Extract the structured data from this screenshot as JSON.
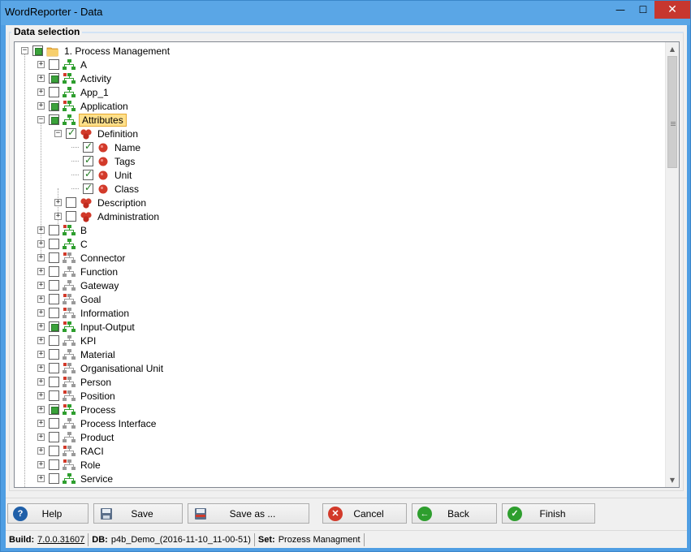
{
  "window": {
    "title": "WordReporter - Data",
    "minimize_glyph": "—",
    "maximize_glyph": "☐",
    "close_glyph": "✕"
  },
  "group": {
    "label": "Data selection"
  },
  "tree": [
    {
      "text": "1. Process Management",
      "level": 0,
      "expander": "−",
      "check": "partial",
      "icon": "folder-icon"
    },
    {
      "text": "A",
      "level": 1,
      "expander": "+",
      "check": "none",
      "icon": "hierarchy-green-icon"
    },
    {
      "text": "Activity",
      "level": 1,
      "expander": "+",
      "check": "partial",
      "icon": "hierarchy-green-red-icon"
    },
    {
      "text": "App_1",
      "level": 1,
      "expander": "+",
      "check": "none",
      "icon": "hierarchy-green-icon"
    },
    {
      "text": "Application",
      "level": 1,
      "expander": "+",
      "check": "partial",
      "icon": "hierarchy-green-red-icon"
    },
    {
      "text": "Attributes",
      "level": 1,
      "expander": "−",
      "check": "partial",
      "icon": "hierarchy-green-icon",
      "selected": true
    },
    {
      "text": "Definition",
      "level": 2,
      "expander": "−",
      "check": "checked",
      "icon": "attribute-group-icon"
    },
    {
      "text": "Name",
      "level": 3,
      "expander": "",
      "check": "checked",
      "icon": "attribute-icon"
    },
    {
      "text": "Tags",
      "level": 3,
      "expander": "",
      "check": "checked",
      "icon": "attribute-icon"
    },
    {
      "text": "Unit",
      "level": 3,
      "expander": "",
      "check": "checked",
      "icon": "attribute-icon"
    },
    {
      "text": "Class",
      "level": 3,
      "expander": "",
      "check": "checked",
      "icon": "attribute-icon"
    },
    {
      "text": "Description",
      "level": 2,
      "expander": "+",
      "check": "none",
      "icon": "attribute-group-icon"
    },
    {
      "text": "Administration",
      "level": 2,
      "expander": "+",
      "check": "none",
      "icon": "attribute-group-icon"
    },
    {
      "text": "B",
      "level": 1,
      "expander": "+",
      "check": "none",
      "icon": "hierarchy-green-red-icon"
    },
    {
      "text": "C",
      "level": 1,
      "expander": "+",
      "check": "none",
      "icon": "hierarchy-green-icon"
    },
    {
      "text": "Connector",
      "level": 1,
      "expander": "+",
      "check": "none",
      "icon": "hierarchy-gray-red-icon"
    },
    {
      "text": "Function",
      "level": 1,
      "expander": "+",
      "check": "none",
      "icon": "hierarchy-gray-icon"
    },
    {
      "text": "Gateway",
      "level": 1,
      "expander": "+",
      "check": "none",
      "icon": "hierarchy-gray-icon"
    },
    {
      "text": "Goal",
      "level": 1,
      "expander": "+",
      "check": "none",
      "icon": "hierarchy-gray-red-icon"
    },
    {
      "text": "Information",
      "level": 1,
      "expander": "+",
      "check": "none",
      "icon": "hierarchy-gray-red-icon"
    },
    {
      "text": "Input-Output",
      "level": 1,
      "expander": "+",
      "check": "partial",
      "icon": "hierarchy-green-red-icon"
    },
    {
      "text": "KPI",
      "level": 1,
      "expander": "+",
      "check": "none",
      "icon": "hierarchy-gray-icon"
    },
    {
      "text": "Material",
      "level": 1,
      "expander": "+",
      "check": "none",
      "icon": "hierarchy-gray-icon"
    },
    {
      "text": "Organisational Unit",
      "level": 1,
      "expander": "+",
      "check": "none",
      "icon": "hierarchy-gray-red-icon"
    },
    {
      "text": "Person",
      "level": 1,
      "expander": "+",
      "check": "none",
      "icon": "hierarchy-gray-red-icon"
    },
    {
      "text": "Position",
      "level": 1,
      "expander": "+",
      "check": "none",
      "icon": "hierarchy-gray-red-icon"
    },
    {
      "text": "Process",
      "level": 1,
      "expander": "+",
      "check": "partial",
      "icon": "hierarchy-green-red-icon"
    },
    {
      "text": "Process Interface",
      "level": 1,
      "expander": "+",
      "check": "none",
      "icon": "hierarchy-gray-icon"
    },
    {
      "text": "Product",
      "level": 1,
      "expander": "+",
      "check": "none",
      "icon": "hierarchy-gray-icon"
    },
    {
      "text": "RACI",
      "level": 1,
      "expander": "+",
      "check": "none",
      "icon": "hierarchy-gray-red-icon"
    },
    {
      "text": "Role",
      "level": 1,
      "expander": "+",
      "check": "none",
      "icon": "hierarchy-gray-red-icon"
    },
    {
      "text": "Service",
      "level": 1,
      "expander": "+",
      "check": "none",
      "icon": "hierarchy-green-icon"
    }
  ],
  "buttons": {
    "help": "Help",
    "save": "Save",
    "save_as": "Save as ...",
    "cancel": "Cancel",
    "back": "Back",
    "finish": "Finish"
  },
  "status": {
    "build_label": "Build:",
    "build_value": "7.0.0.31607",
    "db_label": "DB:",
    "db_value": "p4b_Demo_(2016-11-10_11-00-51)",
    "set_label": "Set:",
    "set_value": "Prozess Managment"
  },
  "colors": {
    "green": "#2e9e2e",
    "red": "#d23a2a",
    "gray": "#9a9a9a",
    "folder": "#f2b544",
    "selection": "#ffe08a"
  }
}
